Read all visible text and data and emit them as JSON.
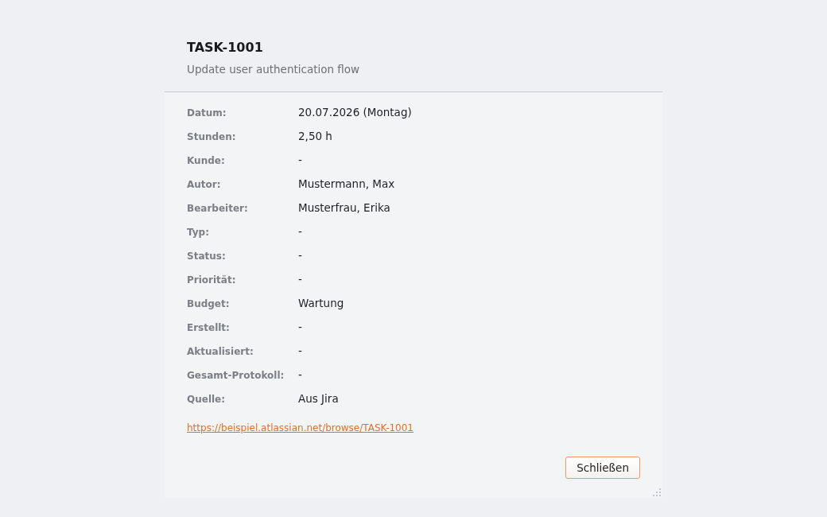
{
  "dialog": {
    "title": "TASK-1001",
    "subtitle": "Update user authentication flow",
    "fields": [
      {
        "label": "Datum:",
        "value": "20.07.2026 (Montag)"
      },
      {
        "label": "Stunden:",
        "value": "2,50 h"
      },
      {
        "label": "Kunde:",
        "value": "-"
      },
      {
        "label": "Autor:",
        "value": "Mustermann, Max"
      },
      {
        "label": "Bearbeiter:",
        "value": "Musterfrau, Erika"
      },
      {
        "label": "Typ:",
        "value": "-"
      },
      {
        "label": "Status:",
        "value": "-"
      },
      {
        "label": "Priorität:",
        "value": "-"
      },
      {
        "label": "Budget:",
        "value": "Wartung"
      },
      {
        "label": "Erstellt:",
        "value": "-"
      },
      {
        "label": "Aktualisiert:",
        "value": "-"
      },
      {
        "label": "Gesamt-Protokoll:",
        "value": "-"
      },
      {
        "label": "Quelle:",
        "value": "Aus Jira"
      }
    ],
    "link": "https://beispiel.atlassian.net/browse/TASK-1001",
    "buttons": [
      "Schließen"
    ]
  }
}
